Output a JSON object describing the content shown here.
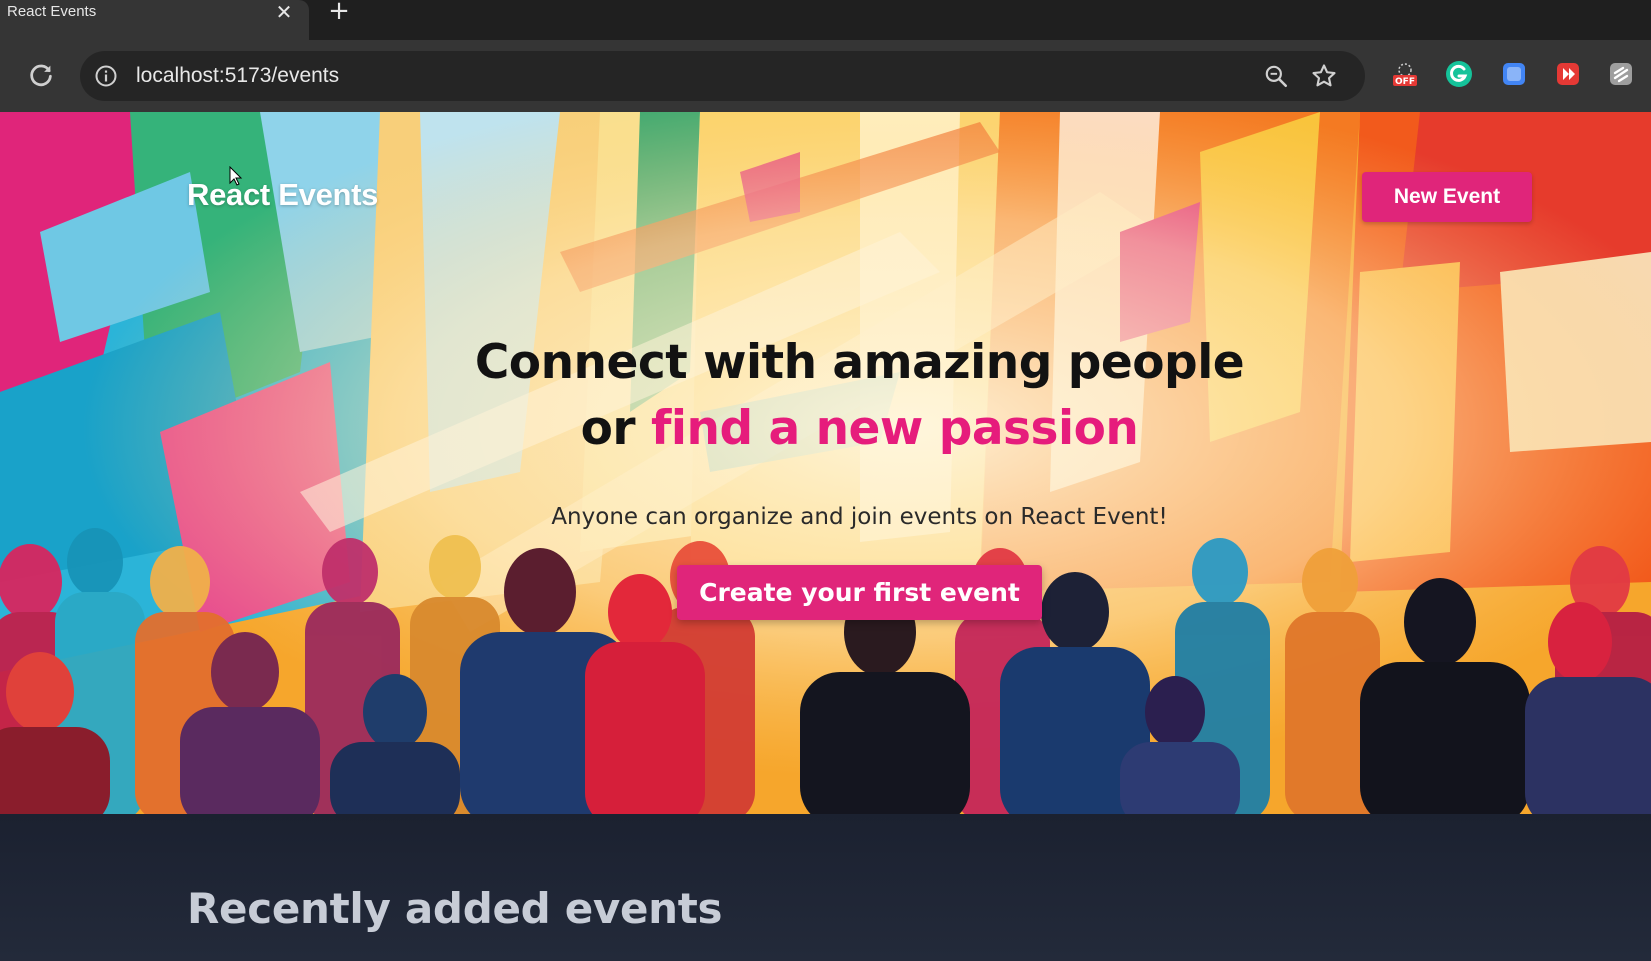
{
  "browser": {
    "tab_title": "React Events",
    "tab_close_glyph": "✕",
    "new_tab_glyph": "+",
    "url": "localhost:5173/events",
    "extensions": [
      {
        "name": "extension-off-icon",
        "color": "#e53935",
        "label": "OFF"
      },
      {
        "name": "grammarly-icon",
        "color": "#15c39a"
      },
      {
        "name": "extension-blue-icon",
        "color": "#4285f4"
      },
      {
        "name": "extension-red-icon",
        "color": "#e53935"
      },
      {
        "name": "extension-gray-icon",
        "color": "#9e9e9e"
      }
    ]
  },
  "nav": {
    "brand": "React Events",
    "new_event_label": "New Event"
  },
  "hero": {
    "headline_line1": "Connect with amazing people",
    "headline_line2_prefix": "or ",
    "headline_line2_highlight": "find a new passion",
    "tagline": "Anyone can organize and join events on React Event!",
    "cta_label": "Create your first event",
    "accent_color": "#e0257a"
  },
  "recent": {
    "title": "Recently added events"
  }
}
